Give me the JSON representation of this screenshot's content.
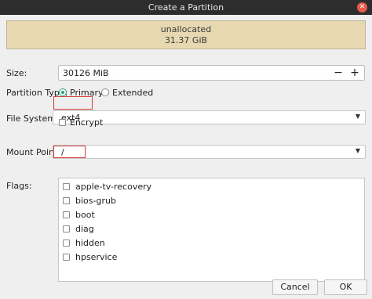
{
  "window": {
    "title": "Create a Partition",
    "close_icon": "close-icon"
  },
  "partition": {
    "name": "unallocated",
    "size": "31.37 GiB"
  },
  "size": {
    "label": "Size:",
    "value": "30126 MiB",
    "decrement": "−",
    "increment": "+"
  },
  "partition_type": {
    "label": "Partition Type:",
    "options": [
      {
        "label": "Primary",
        "checked": true
      },
      {
        "label": "Extended",
        "checked": false
      }
    ]
  },
  "file_system": {
    "label": "File System:",
    "value": "ext4"
  },
  "encrypt": {
    "label": "Encrypt",
    "checked": false
  },
  "mount_point": {
    "label": "Mount Point:",
    "value": "/"
  },
  "flags": {
    "label": "Flags:",
    "items": [
      "apple-tv-recovery",
      "bios-grub",
      "boot",
      "diag",
      "hidden",
      "hpservice"
    ]
  },
  "buttons": {
    "cancel": "Cancel",
    "ok": "OK"
  },
  "colors": {
    "accent": "#2a9d7f",
    "highlight_box": "#d33a3a",
    "partition_fill": "#e7d8b1"
  }
}
